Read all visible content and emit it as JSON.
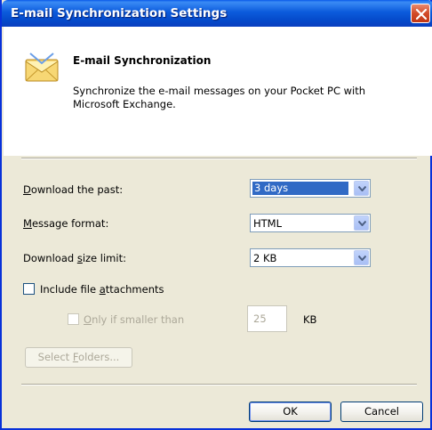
{
  "window": {
    "title": "E-mail Synchronization Settings"
  },
  "header": {
    "title": "E-mail Synchronization",
    "description": "Synchronize the e-mail messages on your Pocket PC with Microsoft Exchange."
  },
  "form": {
    "download_past": {
      "label_accel": "D",
      "label_rest": "ownload the past:",
      "value": "3 days"
    },
    "message_format": {
      "label_accel": "M",
      "label_rest": "essage format:",
      "value": "HTML"
    },
    "size_limit": {
      "label_pre": "Download ",
      "label_accel": "s",
      "label_rest": "ize limit:",
      "value": "2 KB"
    },
    "include_attachments": {
      "label_pre": "Include file ",
      "label_accel": "a",
      "label_rest": "ttachments",
      "checked": false
    },
    "only_if_smaller": {
      "label_accel": "O",
      "label_rest": "nly if smaller than",
      "checked": false,
      "enabled": false
    },
    "smaller_than_value": "25",
    "smaller_than_unit": "KB",
    "select_folders": {
      "label_pre": "Select ",
      "label_accel": "F",
      "label_rest": "olders..."
    }
  },
  "buttons": {
    "ok": "OK",
    "cancel": "Cancel"
  },
  "icons": {
    "close": "close-icon",
    "envelope": "envelope-icon",
    "dropdown": "chevron-down-icon"
  },
  "colors": {
    "titlebar": "#0c5bdc",
    "close": "#d24a28",
    "selection": "#316ac5",
    "face": "#ece9d8"
  }
}
